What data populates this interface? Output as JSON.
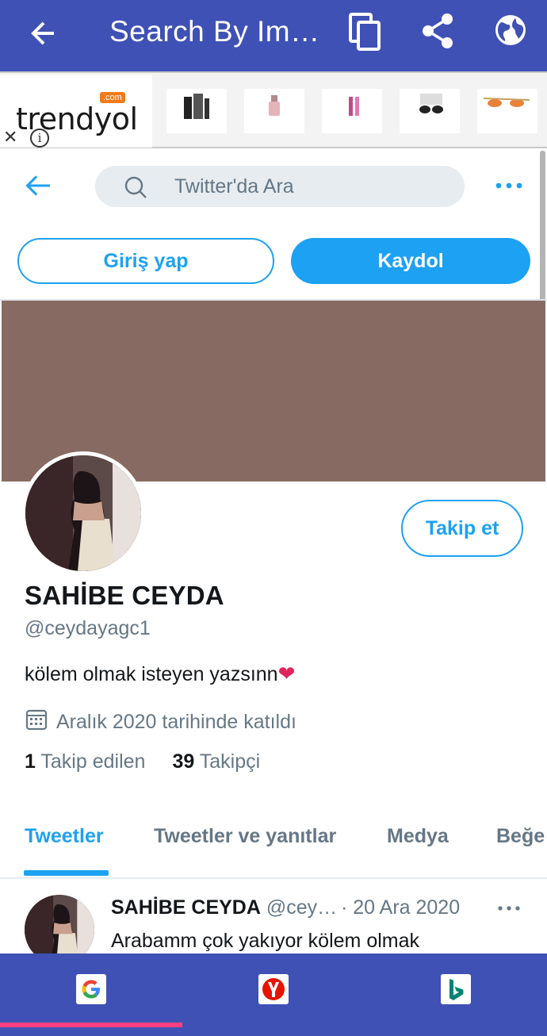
{
  "appbar": {
    "title": "Search By Im…",
    "icons": [
      "back-arrow-icon",
      "copy-icon",
      "share-icon",
      "globe-icon"
    ],
    "color": "#3f51b5"
  },
  "ad": {
    "brand": "trendyol",
    "brand_suffix": ".com",
    "close": "✕",
    "info": "i"
  },
  "twitter": {
    "search_placeholder": "Twitter'da Ara",
    "login_label": "Giriş yap",
    "signup_label": "Kaydol",
    "follow_label": "Takip et",
    "accent": "#1da1f2",
    "banner_color": "#876b62"
  },
  "profile": {
    "name": "SAHİBE CEYDA",
    "handle": "@ceydayagc1",
    "bio": "kölem olmak isteyen yazsınn",
    "bio_emoji": "❤",
    "joined": "Aralık 2020 tarihinde katıldı",
    "following_count": "1",
    "following_label": "Takip edilen",
    "followers_count": "39",
    "followers_label": "Takipçi"
  },
  "tabs": [
    {
      "label": "Tweetler",
      "active": true
    },
    {
      "label": "Tweetler ve yanıtlar",
      "active": false
    },
    {
      "label": "Medya",
      "active": false
    },
    {
      "label": "Beğe",
      "active": false
    }
  ],
  "tweet": {
    "name": "SAHİBE CEYDA",
    "handle": "@cey…",
    "date": "· 20 Ara 2020",
    "text": "Arabamm çok yakıyor kölem olmak"
  },
  "bottombar": {
    "engines": [
      "google-icon",
      "yandex-icon",
      "bing-icon"
    ],
    "indicator_color": "#ff4081"
  }
}
